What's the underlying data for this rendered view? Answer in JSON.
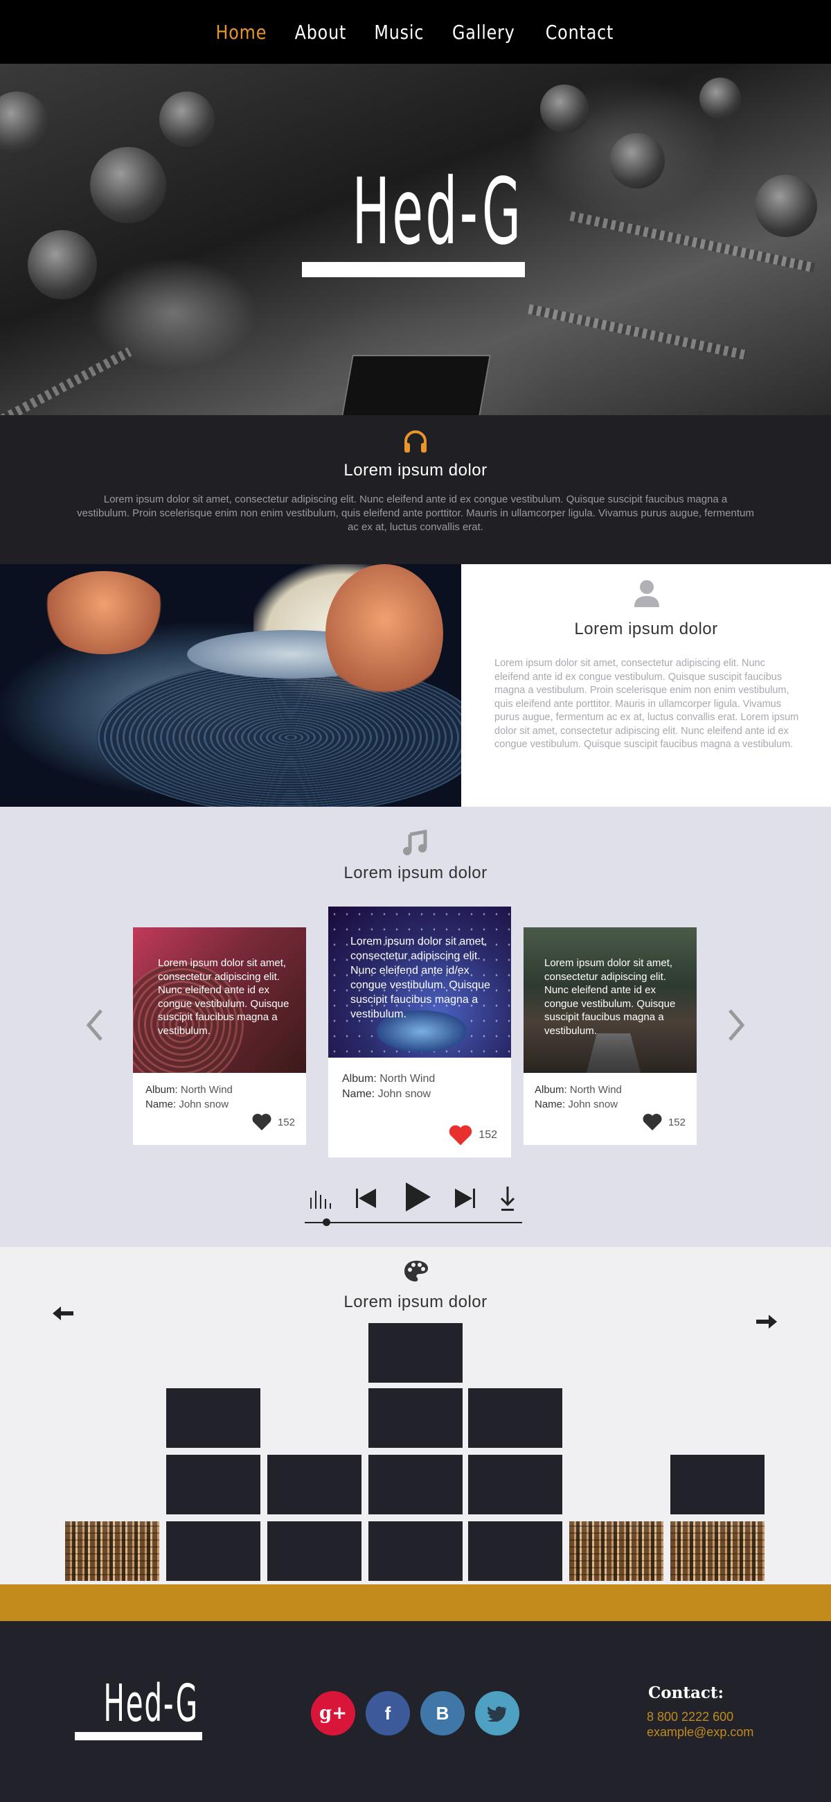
{
  "nav": {
    "items": [
      {
        "label": "Home",
        "active": true
      },
      {
        "label": "About",
        "active": false
      },
      {
        "label": "Music",
        "active": false
      },
      {
        "label": "Gallery",
        "active": false
      },
      {
        "label": "Contact",
        "active": false
      }
    ],
    "active_color": "#e8952e"
  },
  "hero": {
    "logo": "Hed-G"
  },
  "intro": {
    "icon": "headphones-icon",
    "title": "Lorem ipsum dolor",
    "text": "Lorem ipsum dolor sit amet, consectetur adipiscing elit. Nunc eleifend ante id ex congue vestibulum. Quisque suscipit faucibus magna a vestibulum. Proin scelerisque enim non enim vestibulum, quis eleifend ante porttitor. Mauris in ullamcorper ligula. Vivamus purus augue, fermentum ac ex at, luctus convallis erat."
  },
  "about": {
    "icon": "user-icon",
    "title": "Lorem ipsum dolor",
    "text": "Lorem ipsum dolor sit amet, consectetur adipiscing elit. Nunc eleifend ante id ex congue vestibulum. Quisque suscipit faucibus magna a vestibulum. Proin scelerisque enim non enim vestibulum, quis eleifend ante porttitor. Mauris in ullamcorper ligula. Vivamus purus augue, fermentum ac ex at, luctus convallis erat. Lorem ipsum dolor sit amet, consectetur adipiscing elit. Nunc eleifend ante id ex congue vestibulum. Quisque suscipit faucibus magna a vestibulum."
  },
  "music": {
    "icon": "music-note-icon",
    "title": "Lorem ipsum dolor",
    "cards": [
      {
        "text": "Lorem ipsum dolor sit amet, consectetur adipiscing elit. Nunc eleifend ante id ex congue vestibulum. Quisque suscipit faucibus magna a vestibulum.",
        "album_label": "Album:",
        "album": "North Wind",
        "name_label": "Name:",
        "name": "John snow",
        "likes": "152",
        "liked": false
      },
      {
        "text": "Lorem ipsum dolor sit amet, consectetur adipiscing elit. Nunc eleifend ante id/ex congue vestibulum. Quisque suscipit faucibus magna a vestibulum.",
        "album_label": "Album:",
        "album": "North Wind",
        "name_label": "Name:",
        "name": "John snow",
        "likes": "152",
        "liked": true
      },
      {
        "text": "Lorem ipsum dolor sit amet, consectetur adipiscing elit. Nunc eleifend ante id ex congue vestibulum. Quisque suscipit faucibus magna a vestibulum.",
        "album_label": "Album:",
        "album": "North Wind",
        "name_label": "Name:",
        "name": "John snow",
        "likes": "152",
        "liked": false
      }
    ],
    "player": {
      "progress": 0.1
    },
    "like_color": "#e8302f"
  },
  "gallery": {
    "icon": "palette-icon",
    "title": "Lorem ipsum dolor"
  },
  "footer": {
    "logo": "Hed-G",
    "social": [
      {
        "glyph": "g+",
        "name": "google-plus",
        "color": "#d9163a"
      },
      {
        "glyph": "f",
        "name": "facebook",
        "color": "#3c5a99"
      },
      {
        "glyph": "B",
        "name": "vk",
        "color": "#3f78a8"
      },
      {
        "glyph": "",
        "name": "twitter",
        "color": "#4ea1c2"
      }
    ],
    "contact_title": "Contact:",
    "phone": "8 800 2222 600",
    "email": "example@exp.com",
    "accent": "#c38a1c"
  }
}
